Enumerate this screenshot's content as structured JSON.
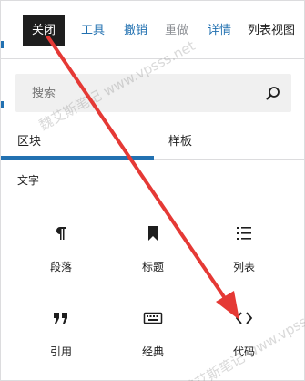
{
  "toolbar": {
    "close_label": "关闭",
    "tools_label": "工具",
    "undo_label": "撤销",
    "redo_label": "重做",
    "details_label": "详情",
    "list_view_label": "列表视图"
  },
  "search": {
    "placeholder": "搜索",
    "icon": "search-icon"
  },
  "tabs": [
    {
      "label": "区块",
      "active": true
    },
    {
      "label": "样板",
      "active": false
    }
  ],
  "category": {
    "title": "文字"
  },
  "blocks": [
    {
      "label": "段落",
      "icon": "paragraph-icon"
    },
    {
      "label": "标题",
      "icon": "bookmark-heading-icon"
    },
    {
      "label": "列表",
      "icon": "list-icon"
    },
    {
      "label": "引用",
      "icon": "quote-icon"
    },
    {
      "label": "经典",
      "icon": "keyboard-icon"
    },
    {
      "label": "代码",
      "icon": "code-icon"
    }
  ],
  "watermark": {
    "text": "魏艾斯笔记 www.vpsss.net"
  },
  "colors": {
    "accent": "#2271b1",
    "arrow": "#e53935",
    "close_bg": "#1e1e1e",
    "search_bg": "#f0f0f0"
  }
}
